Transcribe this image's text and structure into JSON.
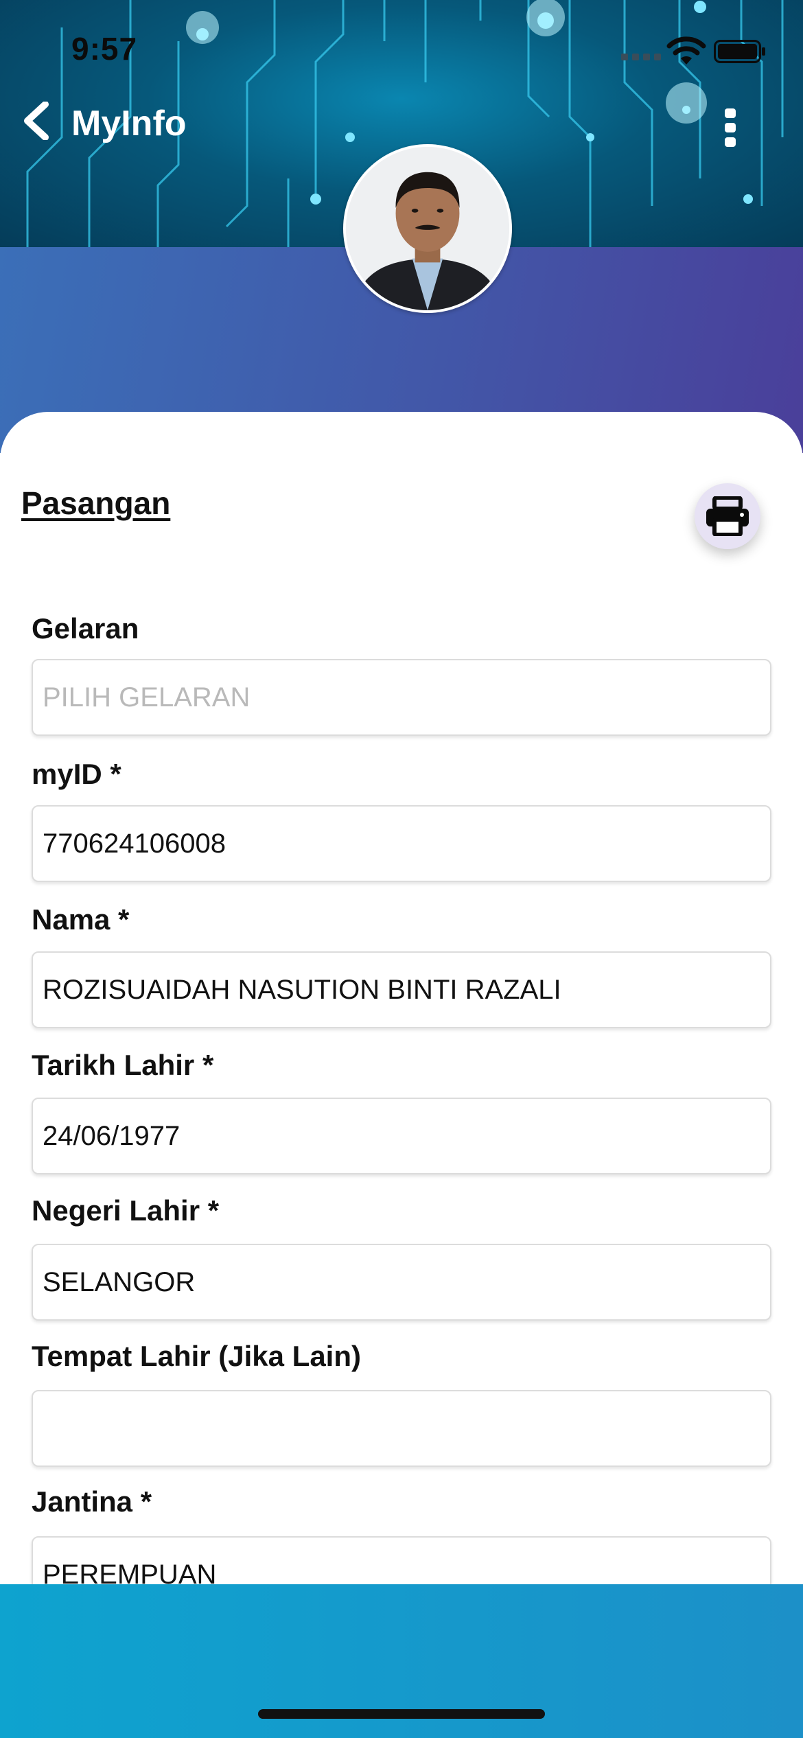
{
  "status_bar": {
    "time": "9:57"
  },
  "nav": {
    "title": "MyInfo"
  },
  "section": {
    "title": "Pasangan"
  },
  "form": {
    "fields": [
      {
        "label": "Gelaran",
        "value": "",
        "placeholder": "PILIH GELARAN"
      },
      {
        "label": "myID *",
        "value": "770624106008",
        "placeholder": ""
      },
      {
        "label": "Nama *",
        "value": "ROZISUAIDAH NASUTION BINTI RAZALI",
        "placeholder": ""
      },
      {
        "label": "Tarikh Lahir *",
        "value": "24/06/1977",
        "placeholder": ""
      },
      {
        "label": "Negeri Lahir *",
        "value": "SELANGOR",
        "placeholder": ""
      },
      {
        "label": "Tempat Lahir (Jika Lain)",
        "value": "",
        "placeholder": ""
      },
      {
        "label": "Jantina *",
        "value": "PEREMPUAN",
        "placeholder": ""
      }
    ]
  },
  "icons": {
    "back": "chevron-left-icon",
    "menu": "more-vertical-icon",
    "print": "printer-icon"
  },
  "colors": {
    "header_dark": "#053c59",
    "band_start": "#3b6fb8",
    "band_end": "#4a3f9a",
    "print_button_bg": "#e7e2f4",
    "bottom_bar": "#0ea3cf"
  }
}
